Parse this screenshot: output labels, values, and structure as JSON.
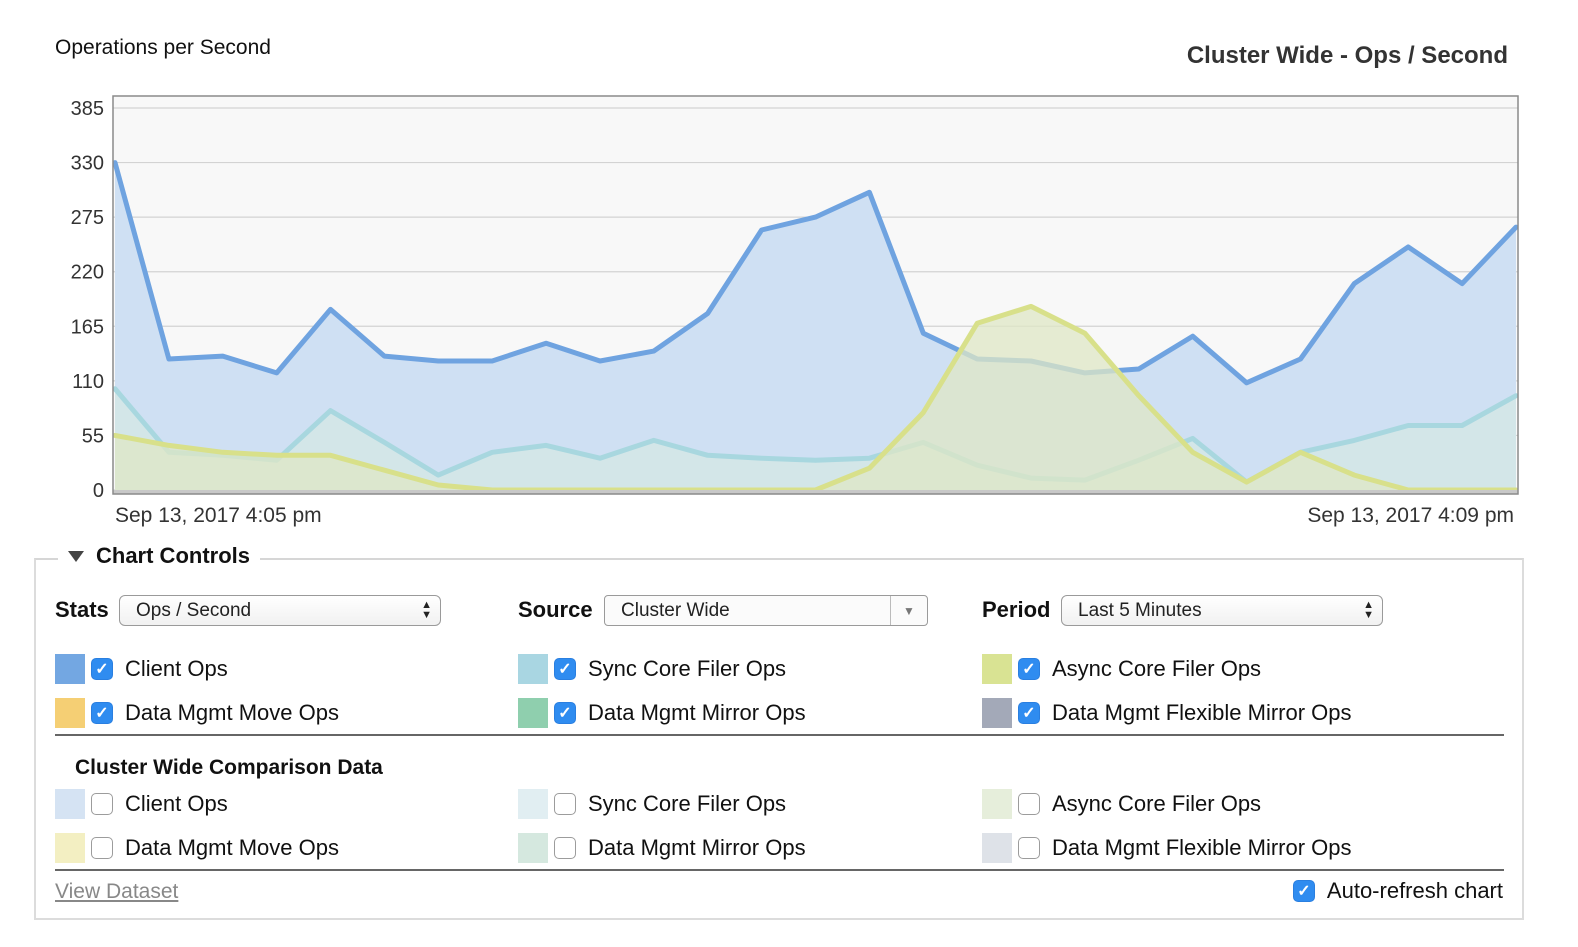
{
  "chart_header": {
    "ylabel": "Operations per Second",
    "title": "Cluster Wide - Ops / Second"
  },
  "chart_data": {
    "type": "area",
    "ylim": [
      0,
      385
    ],
    "y_ticks": [
      "385",
      "330",
      "275",
      "220",
      "165",
      "110",
      "55",
      "0"
    ],
    "x_start_label": "Sep 13, 2017 4:05 pm",
    "x_end_label": "Sep 13, 2017 4:09 pm",
    "grid": true,
    "series": [
      {
        "name": "Client Ops",
        "color": "#6fa3e0",
        "fill": "#cfe0f3",
        "values": [
          330,
          132,
          135,
          118,
          182,
          135,
          130,
          130,
          148,
          130,
          140,
          178,
          262,
          275,
          300,
          158,
          132,
          130,
          118,
          122,
          155,
          108,
          132,
          208,
          245,
          208,
          265
        ]
      },
      {
        "name": "Sync Core Filer Ops",
        "color": "#a8d7df",
        "fill": "#d4e8e4",
        "values": [
          102,
          38,
          35,
          30,
          80,
          48,
          15,
          38,
          45,
          32,
          50,
          35,
          32,
          30,
          32,
          48,
          25,
          12,
          10,
          30,
          52,
          8,
          38,
          50,
          65,
          65,
          95
        ]
      },
      {
        "name": "Async Core Filer Ops",
        "color": "#d8e08a",
        "fill": "#dfe7c6",
        "values": [
          55,
          45,
          38,
          35,
          35,
          20,
          5,
          0,
          0,
          0,
          0,
          0,
          0,
          0,
          22,
          78,
          168,
          185,
          158,
          95,
          38,
          8,
          38,
          15,
          0,
          0,
          0
        ]
      }
    ]
  },
  "controls": {
    "title": "Chart Controls",
    "stats_label": "Stats",
    "stats_value": "Ops / Second",
    "source_label": "Source",
    "source_value": "Cluster Wide",
    "period_label": "Period",
    "period_value": "Last 5 Minutes",
    "primary": [
      {
        "label": "Client Ops",
        "color": "#73a7e2",
        "checked": true
      },
      {
        "label": "Sync Core Filer Ops",
        "color": "#a9d6e2",
        "checked": true
      },
      {
        "label": "Async Core Filer Ops",
        "color": "#d9e393",
        "checked": true
      },
      {
        "label": "Data Mgmt Move Ops",
        "color": "#f5cf74",
        "checked": true
      },
      {
        "label": "Data Mgmt Mirror Ops",
        "color": "#8fcfae",
        "checked": true
      },
      {
        "label": "Data Mgmt Flexible Mirror Ops",
        "color": "#a3a9b8",
        "checked": true
      }
    ],
    "comparison_title": "Cluster Wide Comparison Data",
    "comparison": [
      {
        "label": "Client Ops",
        "color": "#d5e3f3",
        "checked": false
      },
      {
        "label": "Sync Core Filer Ops",
        "color": "#e1eef2",
        "checked": false
      },
      {
        "label": "Async Core Filer Ops",
        "color": "#e6eedb",
        "checked": false
      },
      {
        "label": "Data Mgmt Move Ops",
        "color": "#f3efc2",
        "checked": false
      },
      {
        "label": "Data Mgmt Mirror Ops",
        "color": "#d5e8df",
        "checked": false
      },
      {
        "label": "Data Mgmt Flexible Mirror Ops",
        "color": "#dee2e8",
        "checked": false
      }
    ],
    "view_dataset": "View Dataset",
    "auto_refresh_label": "Auto-refresh chart",
    "auto_refresh_checked": true
  }
}
